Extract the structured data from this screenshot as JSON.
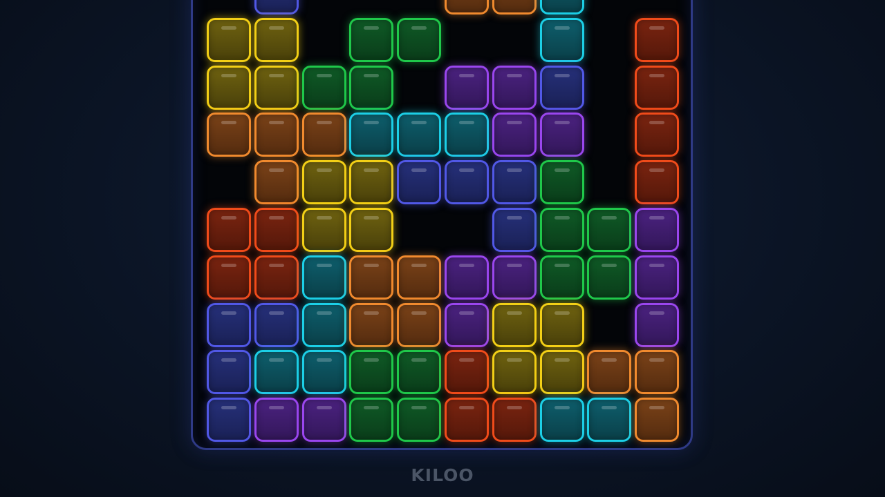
{
  "brand": {
    "label": "KILOO"
  },
  "palette": {
    "Y": {
      "name": "yellow",
      "stroke": "#f2cf16",
      "fill_top": "#6f6210",
      "fill_bottom": "#4a410a",
      "glow": "rgba(242,207,22,0.55)"
    },
    "G": {
      "name": "green",
      "stroke": "#1fc84a",
      "fill_top": "#0f5a26",
      "fill_bottom": "#0a3d1a",
      "glow": "rgba(31,200,74,0.5)"
    },
    "O": {
      "name": "orange",
      "stroke": "#f08a2e",
      "fill_top": "#7a4218",
      "fill_bottom": "#552c0f",
      "glow": "rgba(240,138,46,0.5)"
    },
    "C": {
      "name": "cyan",
      "stroke": "#1ccfe6",
      "fill_top": "#0e5e6c",
      "fill_bottom": "#0a4049",
      "glow": "rgba(28,207,230,0.5)"
    },
    "P": {
      "name": "purple",
      "stroke": "#9a46ee",
      "fill_top": "#4b2280",
      "fill_bottom": "#33175a",
      "glow": "rgba(154,70,238,0.5)"
    },
    "B": {
      "name": "blue",
      "stroke": "#5158e6",
      "fill_top": "#26307a",
      "fill_bottom": "#1a2156",
      "glow": "rgba(81,88,230,0.5)"
    },
    "R": {
      "name": "red",
      "stroke": "#f04b1a",
      "fill_top": "#7a2410",
      "fill_bottom": "#55180a",
      "glow": "rgba(240,75,26,0.5)"
    }
  },
  "board": {
    "columns": 10,
    "visible_rows": 10,
    "rows": [
      [
        ".",
        "B",
        ".",
        ".",
        ".",
        "O",
        "O",
        "C",
        ".",
        "."
      ],
      [
        "Y",
        "Y",
        ".",
        "G",
        "G",
        ".",
        ".",
        "C",
        ".",
        "R"
      ],
      [
        "Y",
        "Y",
        "G",
        "G",
        ".",
        "P",
        "P",
        "B",
        ".",
        "R"
      ],
      [
        "O",
        "O",
        "O",
        "C",
        "C",
        "C",
        "P",
        "P",
        ".",
        "R"
      ],
      [
        ".",
        "O",
        "Y",
        "Y",
        "B",
        "B",
        "B",
        "G",
        ".",
        "R"
      ],
      [
        "R",
        "R",
        "Y",
        "Y",
        ".",
        ".",
        "B",
        "G",
        "G",
        "P"
      ],
      [
        "R",
        "R",
        "C",
        "O",
        "O",
        "P",
        "P",
        "G",
        "G",
        "P"
      ],
      [
        "B",
        "B",
        "C",
        "O",
        "O",
        "P",
        "Y",
        "Y",
        ".",
        "P"
      ],
      [
        "B",
        "C",
        "C",
        "G",
        "G",
        "R",
        "Y",
        "Y",
        "O",
        "O"
      ],
      [
        "B",
        "P",
        "P",
        "G",
        "G",
        "R",
        "R",
        "C",
        "C",
        "O"
      ]
    ]
  }
}
